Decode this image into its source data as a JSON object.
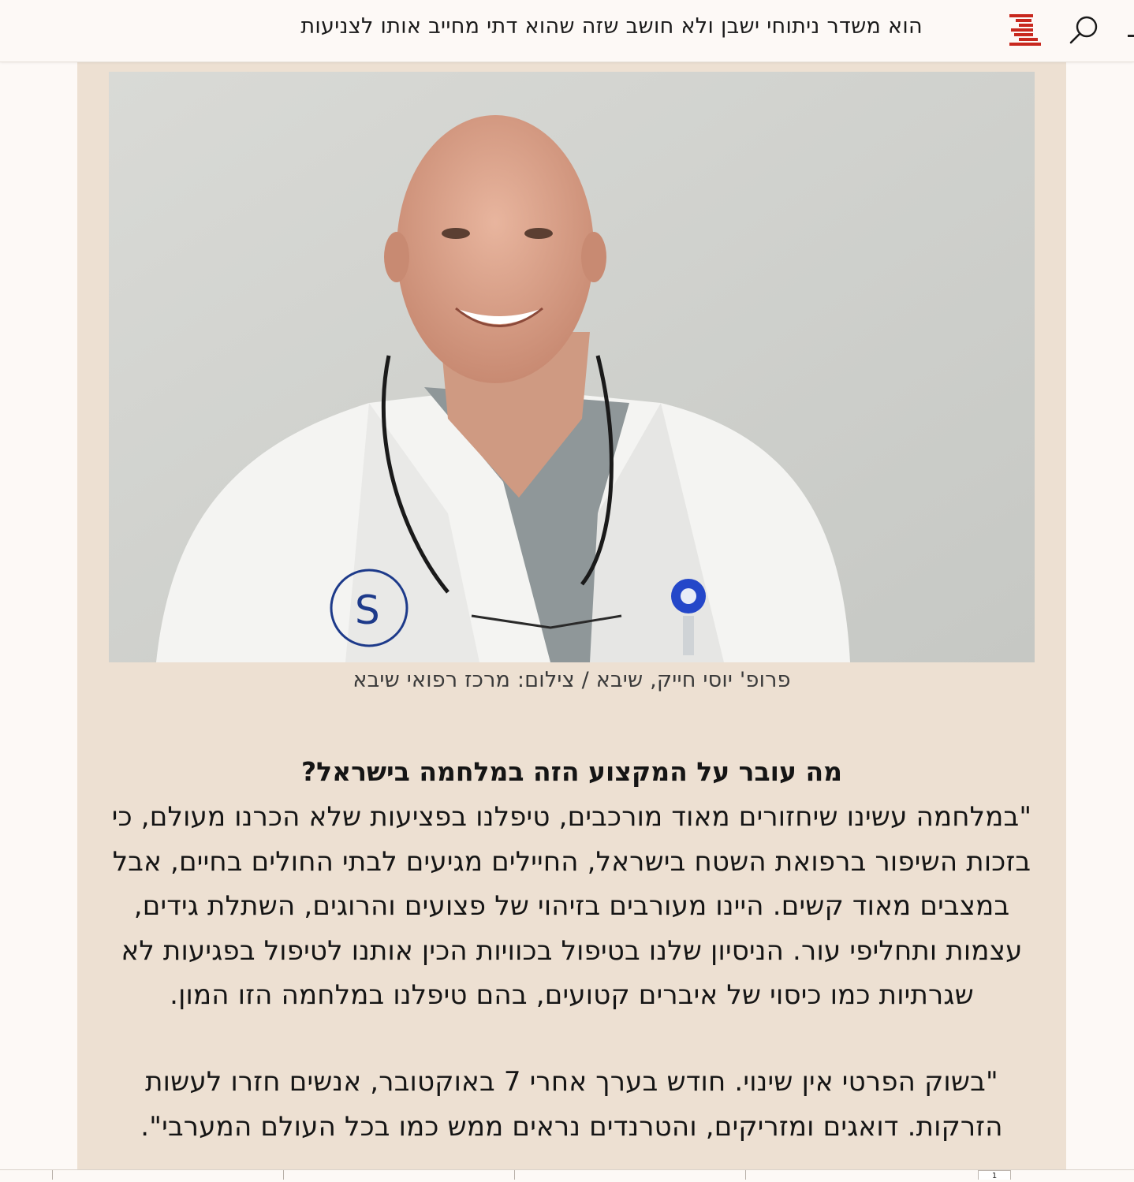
{
  "header": {
    "title": "הוא משדר ניתוחי ישבן ולא חושב שזה שהוא דתי מחייב אותו לצניעות",
    "search_icon": "search-icon",
    "logo_icon": "site-logo-icon",
    "logo_color": "#c8281e"
  },
  "article": {
    "background": "#ede0d2",
    "photo_caption": "פרופ' יוסי חייק, שיבא / צילום: מרכז רפואי שיבא",
    "question": "מה עובר על המקצוע הזה במלחמה בישראל?",
    "paragraphs": [
      {
        "lines": [
          "\"במלחמה עשינו שיחזורים מאוד מורכבים, טיפלנו בפציעות שלא הכרנו מעולם, כי",
          "בזכות השיפור ברפואת השטח בישראל, החיילים מגיעים לבתי החולים בחיים, אבל",
          "במצבים מאוד קשים. היינו מעורבים בזיהוי של פצועים והרוגים, השתלת גידים,",
          "עצמות ותחליפי עור. הניסיון שלנו בטיפול בכוויות הכין אותנו לטיפול בפגיעות לא",
          "שגרתיות כמו כיסוי של איברים קטועים, בהם טיפלנו במלחמה הזו המון."
        ]
      },
      {
        "lines": [
          "\"בשוק הפרטי אין שינוי. חודש בערך אחרי 7 באוקטובר, אנשים חזרו לעשות",
          "הזרקות. דואגים ומזריקים, והטרנדים נראים ממש כמו בכל העולם המערבי\"."
        ]
      }
    ]
  },
  "footer": {
    "page_tab_label": "1"
  }
}
